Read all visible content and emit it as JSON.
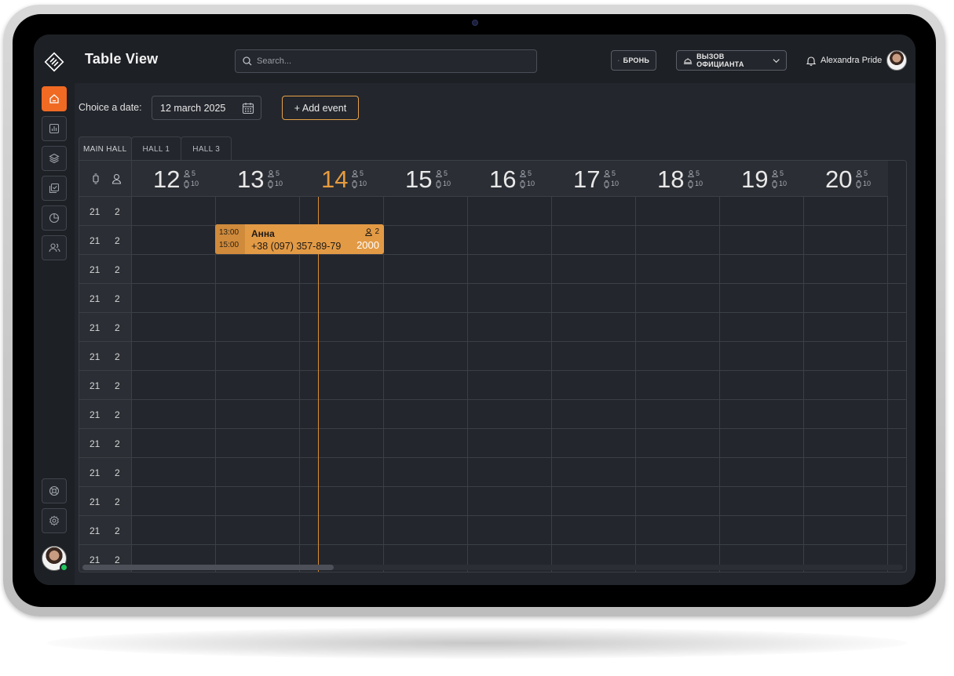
{
  "app": {
    "page_title": "Table View",
    "search": {
      "placeholder": "Search...",
      "icon": "search-icon"
    },
    "header_buttons": {
      "bron_label": "БРОНЬ",
      "waiter_label": "ВЫЗОВ ОФИЦИАНТА"
    },
    "user": {
      "name": "Alexandra Pride"
    }
  },
  "sidebar": {
    "items": [
      {
        "name": "home",
        "icon": "home-icon",
        "active": true
      },
      {
        "name": "analytics",
        "icon": "bar-chart-icon"
      },
      {
        "name": "layers",
        "icon": "layers-icon"
      },
      {
        "name": "tasks",
        "icon": "checklist-icon"
      },
      {
        "name": "reports",
        "icon": "pie-chart-icon"
      },
      {
        "name": "users",
        "icon": "users-icon"
      }
    ],
    "bottom": [
      {
        "name": "support",
        "icon": "lifebuoy-icon"
      },
      {
        "name": "settings",
        "icon": "gear-icon"
      }
    ],
    "status": "online"
  },
  "toolbar": {
    "date_label": "Choice a date:",
    "date_value": "12 march 2025",
    "add_event_label": "+ Add event"
  },
  "halls": {
    "tabs": [
      "MAIN HALL",
      "HALL 1",
      "HALL 3"
    ],
    "active": "MAIN HALL"
  },
  "timeline": {
    "days": [
      {
        "day": "12",
        "guests": "5",
        "tables": "10"
      },
      {
        "day": "13",
        "guests": "5",
        "tables": "10"
      },
      {
        "day": "14",
        "guests": "5",
        "tables": "10",
        "current": true
      },
      {
        "day": "15",
        "guests": "5",
        "tables": "10"
      },
      {
        "day": "16",
        "guests": "5",
        "tables": "10"
      },
      {
        "day": "17",
        "guests": "5",
        "tables": "10"
      },
      {
        "day": "18",
        "guests": "5",
        "tables": "10"
      },
      {
        "day": "19",
        "guests": "5",
        "tables": "10"
      },
      {
        "day": "20",
        "guests": "5",
        "tables": "10"
      }
    ],
    "rows": [
      {
        "table": "21",
        "seats": "2"
      },
      {
        "table": "21",
        "seats": "2"
      },
      {
        "table": "21",
        "seats": "2"
      },
      {
        "table": "21",
        "seats": "2"
      },
      {
        "table": "21",
        "seats": "2"
      },
      {
        "table": "21",
        "seats": "2"
      },
      {
        "table": "21",
        "seats": "2"
      },
      {
        "table": "21",
        "seats": "2"
      },
      {
        "table": "21",
        "seats": "2"
      },
      {
        "table": "21",
        "seats": "2"
      },
      {
        "table": "21",
        "seats": "2"
      },
      {
        "table": "21",
        "seats": "2"
      },
      {
        "table": "21",
        "seats": "2"
      }
    ],
    "booking": {
      "start": "13:00",
      "end": "15:00",
      "name": "Анна",
      "phone": "+38 (097) 357-89-79",
      "guests": "2",
      "amount": "2000"
    }
  },
  "colors": {
    "accent": "#f06a23",
    "booking": "#e39a45",
    "current_day": "#e69a3f",
    "background": "#23262c",
    "online": "#22c55e"
  }
}
